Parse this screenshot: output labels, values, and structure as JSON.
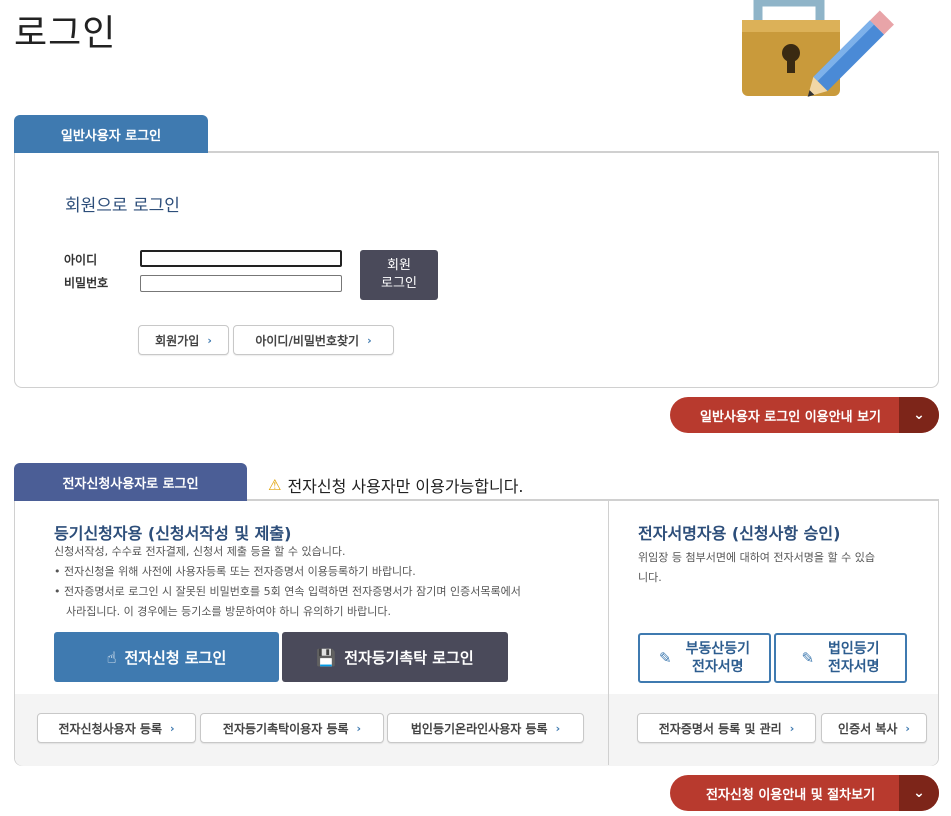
{
  "page": {
    "title": "로그인"
  },
  "general": {
    "tab_label": "일반사용자 로그인",
    "heading": "회원으로 로그인",
    "id_label": "아이디",
    "pw_label": "비밀번호",
    "login_button": {
      "line1": "회원",
      "line2": "로그인"
    },
    "join_button": "회원가입",
    "find_button": "아이디/비밀번호찾기",
    "guide_button": "일반사용자 로그인 이용안내 보기"
  },
  "einfo": {
    "tab_label": "전자신청사용자로 로그인",
    "warning": "전자신청 사용자만 이용가능합니다.",
    "registry": {
      "heading": "등기신청자용 (신청서작성 및 제출)",
      "desc1": "신청서작성, 수수료 전자결제, 신청서 제출 등을 할 수 있습니다.",
      "desc2": "• 전자신청을 위해 사전에 사용자등록 또는 전자증명서 이용등록하기 바랍니다.",
      "desc3": "• 전자증명서로 로그인 시 잘못된 비밀번호를 5회 연속 입력하면 전자증명서가 잠기며 인증서목록에서",
      "desc4": "사라집니다. 이 경우에는 등기소를 방문하여야 하니 유의하기 바랍니다.",
      "elogin_button": "전자신청 로그인",
      "trust_button": "전자등기촉탁 로그인"
    },
    "sign": {
      "heading": "전자서명자용 (신청사항 승인)",
      "desc1": "위임장 등 첨부서면에 대하여 전자서명을 할 수 있습",
      "desc2": "니다.",
      "realestate_button": {
        "line1": "부동산등기",
        "line2": "전자서명"
      },
      "corp_button": {
        "line1": "법인등기",
        "line2": "전자서명"
      }
    },
    "footer_buttons": {
      "reg_user": "전자신청사용자 등록",
      "reg_trust": "전자등기촉탁이용자 등록",
      "reg_corp": "법인등기온라인사용자 등록",
      "cert_manage": "전자증명서 등록 및 관리",
      "cert_copy": "인증서 복사"
    },
    "guide_button": "전자신청 이용안내 및 절차보기"
  },
  "colors": {
    "tab_blue": "#3f7ab0",
    "tab_indigo": "#4b5e96",
    "dark_button": "#4a4a5a",
    "guide_red": "#b83a2e",
    "heading_blue": "#2d4e7a"
  }
}
